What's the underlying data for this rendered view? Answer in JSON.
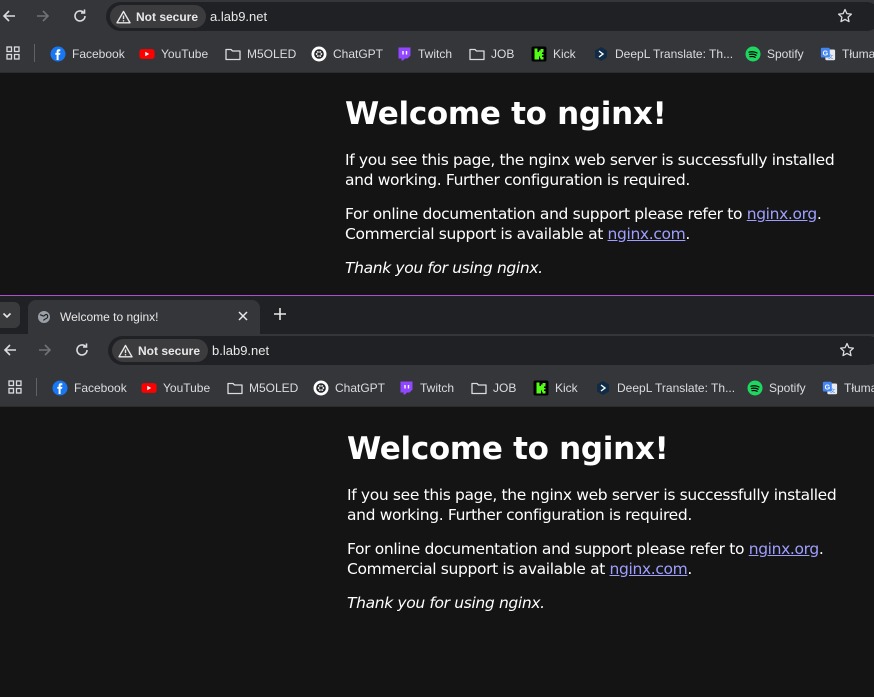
{
  "colors": {
    "link": "#9e9eff",
    "divider": "#b04fcf",
    "page_bg": "#141414",
    "toolbar_bg": "#35363a"
  },
  "bookmarks": [
    {
      "label": "Facebook",
      "icon": "facebook-icon"
    },
    {
      "label": "YouTube",
      "icon": "youtube-icon"
    },
    {
      "label": "M5OLED",
      "icon": "folder-icon"
    },
    {
      "label": "ChatGPT",
      "icon": "chatgpt-icon"
    },
    {
      "label": "Twitch",
      "icon": "twitch-icon"
    },
    {
      "label": "JOB",
      "icon": "folder-icon"
    },
    {
      "label": "Kick",
      "icon": "kick-icon"
    },
    {
      "label": "DeepL Translate: Th...",
      "icon": "deepl-icon"
    },
    {
      "label": "Spotify",
      "icon": "spotify-icon"
    },
    {
      "label": "Tłuma",
      "icon": "google-translate-icon"
    }
  ],
  "windows": [
    {
      "security_label": "Not secure",
      "url": "a.lab9.net"
    },
    {
      "tab_title": "Welcome to nginx!",
      "security_label": "Not secure",
      "url": "b.lab9.net"
    }
  ],
  "nginx_page": {
    "heading": "Welcome to nginx!",
    "para1": "If you see this page, the nginx web server is successfully installed and working. Further configuration is required.",
    "para2_prefix": "For online documentation and support please refer to ",
    "doc_link": "nginx.org",
    "para2_middle": ". Commercial support is available at ",
    "support_link": "nginx.com",
    "para2_suffix": ".",
    "thanks": "Thank you for using nginx."
  }
}
